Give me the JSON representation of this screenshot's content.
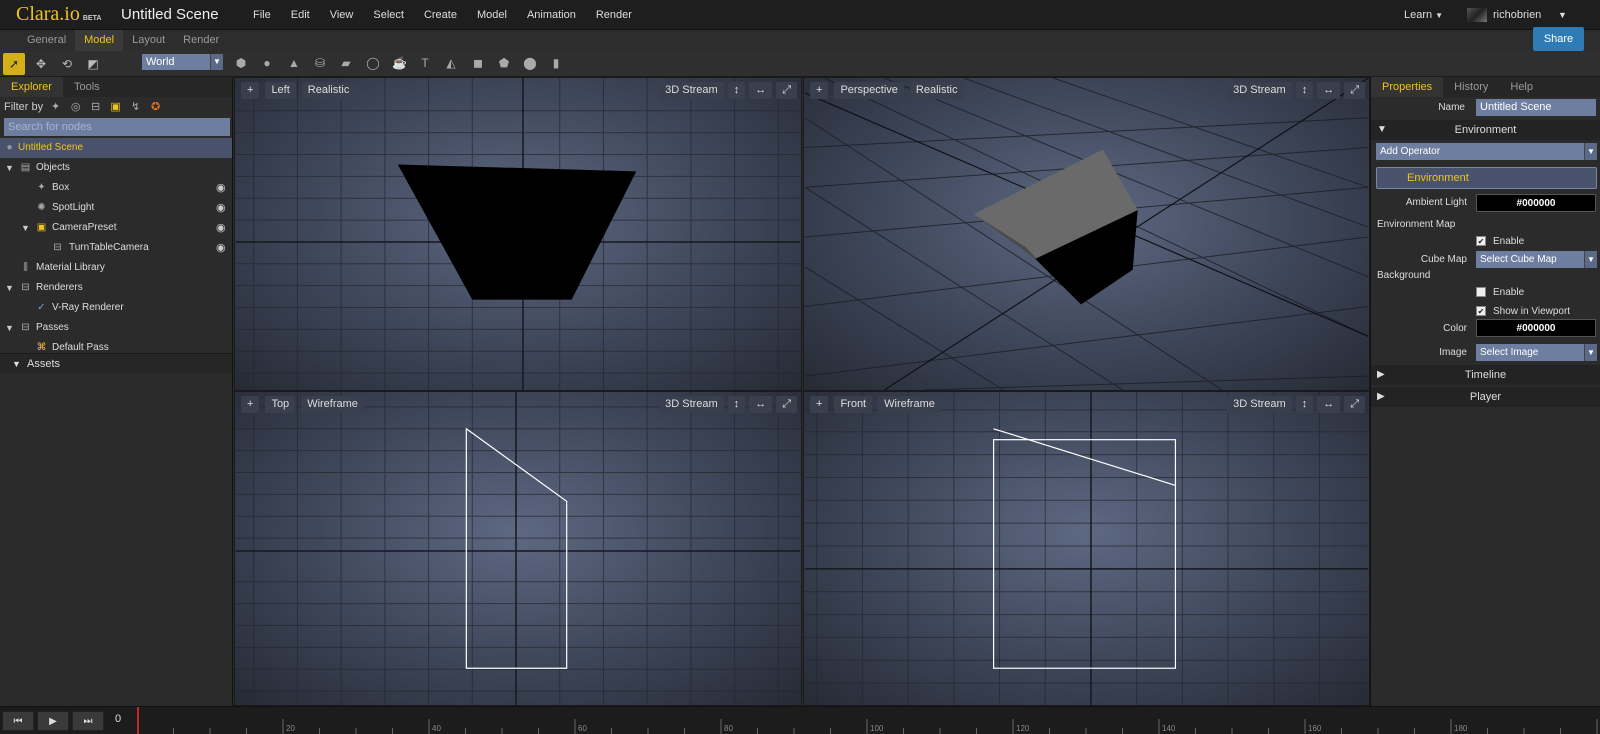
{
  "app": {
    "logo": "Clara.io",
    "beta": "BETA",
    "scene_title": "Untitled Scene"
  },
  "menu": [
    "File",
    "Edit",
    "View",
    "Select",
    "Create",
    "Model",
    "Animation",
    "Render"
  ],
  "user_menu": {
    "learn": "Learn",
    "username": "richobrien"
  },
  "mode_tabs": {
    "items": [
      "General",
      "Model",
      "Layout",
      "Render"
    ],
    "active": "Model"
  },
  "share_label": "Share",
  "toolbar": {
    "coord_space": "World"
  },
  "left_panel": {
    "tabs": [
      "Explorer",
      "Tools"
    ],
    "active_tab": "Explorer",
    "filter_label": "Filter by",
    "search_placeholder": "Search for nodes",
    "tree": [
      {
        "label": "Untitled Scene",
        "icon": "scene-icon",
        "selected": true
      },
      {
        "label": "Objects",
        "icon": "folder-icon"
      },
      {
        "label": "Box",
        "icon": "mesh-icon"
      },
      {
        "label": "SpotLight",
        "icon": "light-icon"
      },
      {
        "label": "CameraPreset",
        "icon": "camera-preset-icon"
      },
      {
        "label": "TurnTableCamera",
        "icon": "camera-icon"
      },
      {
        "label": "Material Library",
        "icon": "material-library-icon"
      },
      {
        "label": "Renderers",
        "icon": "renderers-icon"
      },
      {
        "label": "V-Ray Renderer",
        "icon": "vray-icon"
      },
      {
        "label": "Passes",
        "icon": "passes-icon"
      },
      {
        "label": "Default Pass",
        "icon": "pass-icon"
      }
    ],
    "assets_label": "Assets"
  },
  "viewports": [
    {
      "view": "Left",
      "shading": "Realistic",
      "stream": "3D Stream"
    },
    {
      "view": "Perspective",
      "shading": "Realistic",
      "stream": "3D Stream"
    },
    {
      "view": "Top",
      "shading": "Wireframe",
      "stream": "3D Stream"
    },
    {
      "view": "Front",
      "shading": "Wireframe",
      "stream": "3D Stream"
    }
  ],
  "right_panel": {
    "tabs": [
      "Properties",
      "History",
      "Help"
    ],
    "active_tab": "Properties",
    "name_label": "Name",
    "name_value": "Untitled Scene",
    "environment_section": "Environment",
    "add_operator": "Add Operator",
    "environment_operator": "Environment",
    "ambient_light_label": "Ambient Light",
    "ambient_light_value": "#000000",
    "environment_map_title": "Environment Map",
    "env_map_enable_label": "Enable",
    "env_map_enable": true,
    "cube_map_label": "Cube Map",
    "cube_map_value": "Select Cube Map",
    "background_title": "Background",
    "bg_enable_label": "Enable",
    "bg_enable": false,
    "show_in_viewport_label": "Show in Viewport",
    "show_in_viewport": true,
    "color_label": "Color",
    "color_value": "#000000",
    "image_label": "Image",
    "image_value": "Select Image",
    "timeline_section": "Timeline",
    "player_section": "Player"
  },
  "timeline": {
    "current_frame": "0",
    "start": 0,
    "end": 180,
    "labels": [
      "20",
      "40",
      "60",
      "80",
      "100",
      "120",
      "140",
      "160",
      "180"
    ]
  },
  "colors": {
    "accent": "#f0c419",
    "share": "#2f7bb5",
    "input": "#6e7ea0",
    "selection": "#49526b",
    "playhead": "#c62828"
  }
}
